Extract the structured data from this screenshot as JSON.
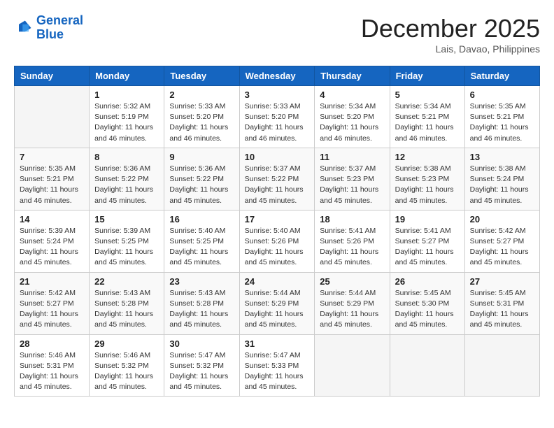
{
  "header": {
    "logo_line1": "General",
    "logo_line2": "Blue",
    "month": "December 2025",
    "location": "Lais, Davao, Philippines"
  },
  "weekdays": [
    "Sunday",
    "Monday",
    "Tuesday",
    "Wednesday",
    "Thursday",
    "Friday",
    "Saturday"
  ],
  "weeks": [
    [
      {
        "day": "",
        "info": ""
      },
      {
        "day": "1",
        "info": "Sunrise: 5:32 AM\nSunset: 5:19 PM\nDaylight: 11 hours\nand 46 minutes."
      },
      {
        "day": "2",
        "info": "Sunrise: 5:33 AM\nSunset: 5:20 PM\nDaylight: 11 hours\nand 46 minutes."
      },
      {
        "day": "3",
        "info": "Sunrise: 5:33 AM\nSunset: 5:20 PM\nDaylight: 11 hours\nand 46 minutes."
      },
      {
        "day": "4",
        "info": "Sunrise: 5:34 AM\nSunset: 5:20 PM\nDaylight: 11 hours\nand 46 minutes."
      },
      {
        "day": "5",
        "info": "Sunrise: 5:34 AM\nSunset: 5:21 PM\nDaylight: 11 hours\nand 46 minutes."
      },
      {
        "day": "6",
        "info": "Sunrise: 5:35 AM\nSunset: 5:21 PM\nDaylight: 11 hours\nand 46 minutes."
      }
    ],
    [
      {
        "day": "7",
        "info": "Sunrise: 5:35 AM\nSunset: 5:21 PM\nDaylight: 11 hours\nand 46 minutes."
      },
      {
        "day": "8",
        "info": "Sunrise: 5:36 AM\nSunset: 5:22 PM\nDaylight: 11 hours\nand 45 minutes."
      },
      {
        "day": "9",
        "info": "Sunrise: 5:36 AM\nSunset: 5:22 PM\nDaylight: 11 hours\nand 45 minutes."
      },
      {
        "day": "10",
        "info": "Sunrise: 5:37 AM\nSunset: 5:22 PM\nDaylight: 11 hours\nand 45 minutes."
      },
      {
        "day": "11",
        "info": "Sunrise: 5:37 AM\nSunset: 5:23 PM\nDaylight: 11 hours\nand 45 minutes."
      },
      {
        "day": "12",
        "info": "Sunrise: 5:38 AM\nSunset: 5:23 PM\nDaylight: 11 hours\nand 45 minutes."
      },
      {
        "day": "13",
        "info": "Sunrise: 5:38 AM\nSunset: 5:24 PM\nDaylight: 11 hours\nand 45 minutes."
      }
    ],
    [
      {
        "day": "14",
        "info": "Sunrise: 5:39 AM\nSunset: 5:24 PM\nDaylight: 11 hours\nand 45 minutes."
      },
      {
        "day": "15",
        "info": "Sunrise: 5:39 AM\nSunset: 5:25 PM\nDaylight: 11 hours\nand 45 minutes."
      },
      {
        "day": "16",
        "info": "Sunrise: 5:40 AM\nSunset: 5:25 PM\nDaylight: 11 hours\nand 45 minutes."
      },
      {
        "day": "17",
        "info": "Sunrise: 5:40 AM\nSunset: 5:26 PM\nDaylight: 11 hours\nand 45 minutes."
      },
      {
        "day": "18",
        "info": "Sunrise: 5:41 AM\nSunset: 5:26 PM\nDaylight: 11 hours\nand 45 minutes."
      },
      {
        "day": "19",
        "info": "Sunrise: 5:41 AM\nSunset: 5:27 PM\nDaylight: 11 hours\nand 45 minutes."
      },
      {
        "day": "20",
        "info": "Sunrise: 5:42 AM\nSunset: 5:27 PM\nDaylight: 11 hours\nand 45 minutes."
      }
    ],
    [
      {
        "day": "21",
        "info": "Sunrise: 5:42 AM\nSunset: 5:27 PM\nDaylight: 11 hours\nand 45 minutes."
      },
      {
        "day": "22",
        "info": "Sunrise: 5:43 AM\nSunset: 5:28 PM\nDaylight: 11 hours\nand 45 minutes."
      },
      {
        "day": "23",
        "info": "Sunrise: 5:43 AM\nSunset: 5:28 PM\nDaylight: 11 hours\nand 45 minutes."
      },
      {
        "day": "24",
        "info": "Sunrise: 5:44 AM\nSunset: 5:29 PM\nDaylight: 11 hours\nand 45 minutes."
      },
      {
        "day": "25",
        "info": "Sunrise: 5:44 AM\nSunset: 5:29 PM\nDaylight: 11 hours\nand 45 minutes."
      },
      {
        "day": "26",
        "info": "Sunrise: 5:45 AM\nSunset: 5:30 PM\nDaylight: 11 hours\nand 45 minutes."
      },
      {
        "day": "27",
        "info": "Sunrise: 5:45 AM\nSunset: 5:31 PM\nDaylight: 11 hours\nand 45 minutes."
      }
    ],
    [
      {
        "day": "28",
        "info": "Sunrise: 5:46 AM\nSunset: 5:31 PM\nDaylight: 11 hours\nand 45 minutes."
      },
      {
        "day": "29",
        "info": "Sunrise: 5:46 AM\nSunset: 5:32 PM\nDaylight: 11 hours\nand 45 minutes."
      },
      {
        "day": "30",
        "info": "Sunrise: 5:47 AM\nSunset: 5:32 PM\nDaylight: 11 hours\nand 45 minutes."
      },
      {
        "day": "31",
        "info": "Sunrise: 5:47 AM\nSunset: 5:33 PM\nDaylight: 11 hours\nand 45 minutes."
      },
      {
        "day": "",
        "info": ""
      },
      {
        "day": "",
        "info": ""
      },
      {
        "day": "",
        "info": ""
      }
    ]
  ]
}
